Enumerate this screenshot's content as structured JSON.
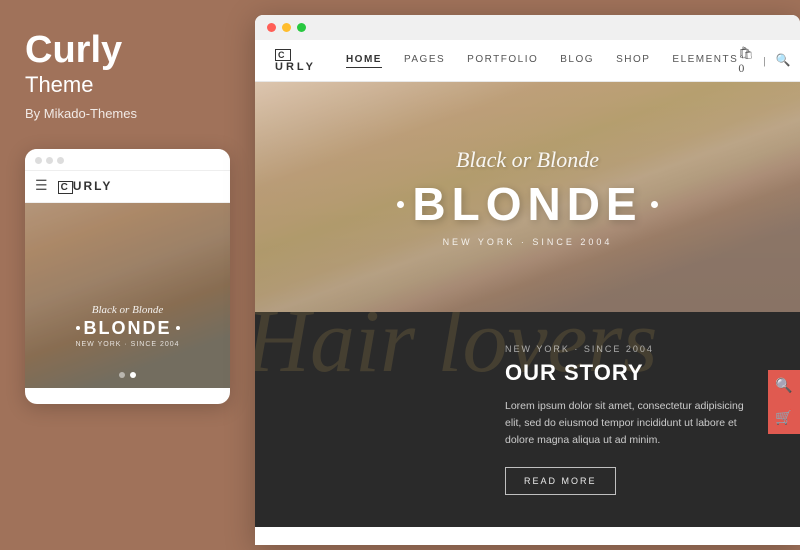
{
  "app": {
    "title": "Curly",
    "subtitle": "Theme",
    "author": "By Mikado-Themes"
  },
  "mobile": {
    "logo": "CURLY",
    "logo_c": "C",
    "script_text": "Black or Blonde",
    "headline": "BLONDE",
    "since": "NEW YORK · SINCE 2004",
    "dots_count": 2
  },
  "browser": {
    "nav_items": [
      "HOME",
      "PAGES",
      "PORTFOLIO",
      "BLOG",
      "SHOP",
      "ELEMENTS"
    ],
    "active_nav": "HOME",
    "logo": "CURLY",
    "logo_c": "C",
    "hero": {
      "script_text": "Black or Blonde",
      "headline": "BLONDE",
      "since": "NEW YORK · SINCE 2004"
    },
    "story": {
      "script_bg": "Hair lovers",
      "location": "NEW YORK · SINCE 2004",
      "title": "OUR STORY",
      "body": "Lorem ipsum dolor sit amet, consectetur adipisicing elit, sed do eiusmod tempor incididunt ut labore et dolore magna aliqua ut ad minim.",
      "button_label": "READ MORE"
    }
  },
  "colors": {
    "background": "#a0725a",
    "browser_bg": "#fff",
    "story_bg": "#2a2a2a",
    "accent": "#e05a50"
  }
}
